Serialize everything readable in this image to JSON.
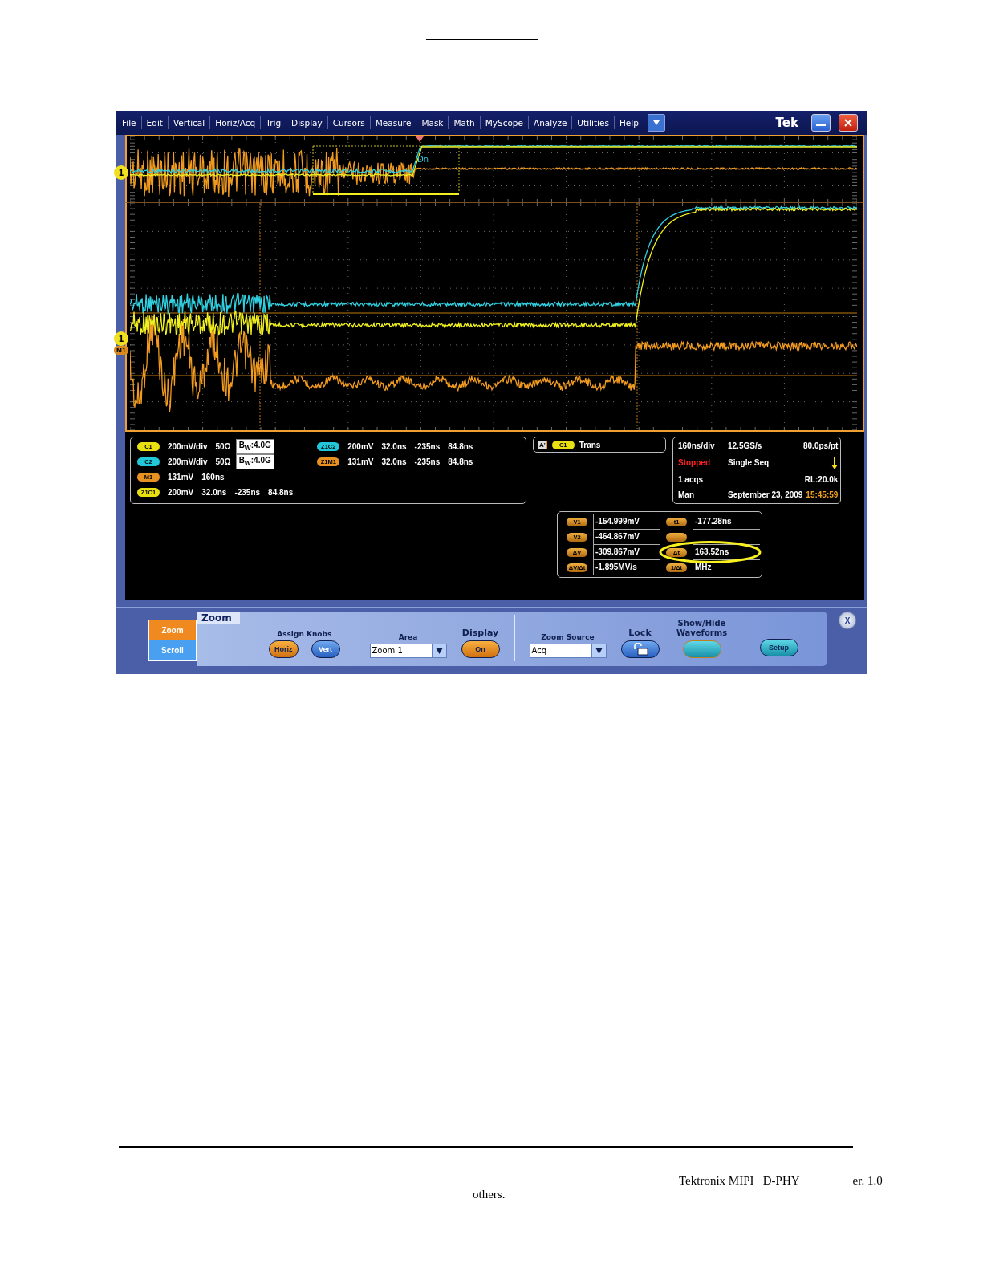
{
  "menu_bar": {
    "items": [
      "File",
      "Edit",
      "Vertical",
      "Horiz/Acq",
      "Trig",
      "Display",
      "Cursors",
      "Measure",
      "Mask",
      "Math",
      "MyScope",
      "Analyze",
      "Utilities",
      "Help"
    ],
    "logo": "Tek"
  },
  "overview_plot": {
    "marker": "1",
    "labels": [
      "Dn"
    ]
  },
  "zoom_plot": {
    "markers": [
      "1",
      "M1"
    ]
  },
  "channel_readouts": {
    "column_1": [
      {
        "badge": "C1",
        "color": "#e8e010",
        "values": [
          "200mV/div",
          "50Ω"
        ],
        "bandwidth": "B$_{W}$:4.0G"
      },
      {
        "badge": "C2",
        "color": "#20c8d8",
        "values": [
          "200mV/div",
          "50Ω"
        ],
        "bandwidth": "B$_{W}$:4.0G"
      },
      {
        "badge": "M1",
        "color": "#e89020",
        "values": [
          "131mV",
          "160ns"
        ]
      },
      {
        "badge": "Z1C1",
        "color": "#e8e010",
        "values": [
          "200mV",
          "32.0ns",
          "-235ns",
          "84.8ns"
        ]
      }
    ],
    "column_2": [
      {
        "badge": "Z1C2",
        "color": "#20c8d8",
        "values": [
          "200mV",
          "32.0ns",
          "-235ns",
          "84.8ns"
        ]
      },
      {
        "badge": "Z1M1",
        "color": "#e89020",
        "values": [
          "131mV",
          "32.0ns",
          "-235ns",
          "84.8ns"
        ]
      }
    ]
  },
  "trigger_readout": {
    "label": "A'",
    "badge": "C1",
    "type": "Trans"
  },
  "horizontal_readout": {
    "rows": [
      {
        "cells": [
          {
            "text": "160ns/div"
          },
          {
            "text": "12.5GS/s"
          },
          {
            "text": "80.0ps/pt"
          }
        ]
      },
      {
        "cells": [
          {
            "text": "Stopped",
            "color": "#ff2020"
          },
          {
            "text": "Single Seq"
          }
        ],
        "trigger_arrow": true
      },
      {
        "cells": [
          {
            "text": "1 acqs"
          },
          {
            "text": ""
          },
          {
            "text": "RL:20.0k"
          }
        ]
      },
      {
        "cells": [
          {
            "text": "Man"
          },
          {
            "text": "September 23, 2009"
          },
          {
            "text": "15:45:59",
            "color": "#f0a020"
          }
        ]
      }
    ]
  },
  "cursor_readout": [
    {
      "kind": "reading",
      "label": "V1",
      "value": "-154.999mV"
    },
    {
      "kind": "reading",
      "label": "t1",
      "value": "-177.28ns"
    },
    {
      "kind": "reading",
      "label": "V2",
      "value": "-464.867mV"
    },
    {
      "kind": "hidden"
    },
    {
      "kind": "reading",
      "label": "ΔV",
      "value": "-309.867mV"
    },
    {
      "kind": "reading",
      "label": "Δt",
      "value": "163.52ns"
    },
    {
      "kind": "reading",
      "label": "ΔV/Δt",
      "value": "-1.895MV/s"
    },
    {
      "kind": "reading",
      "label": "1/Δt",
      "value": "MHz"
    }
  ],
  "control_panel": {
    "tabs": [
      {
        "label": "Zoom",
        "selected": true
      },
      {
        "label": "Scroll",
        "selected": false
      }
    ],
    "title": "Zoom",
    "assign_knobs": {
      "label": "Assign Knobs",
      "buttons": [
        {
          "label": "Horiz",
          "selected": true
        },
        {
          "label": "Vert",
          "selected": false
        }
      ]
    },
    "area": {
      "label": "Area",
      "value": "Zoom 1"
    },
    "display": {
      "label": "Display",
      "button": "On"
    },
    "zoom_source": {
      "label": "Zoom Source",
      "value": "Acq"
    },
    "lock": {
      "label": "Lock"
    },
    "show_hide": {
      "label": "Show/Hide Waveforms"
    },
    "setup": "Setup",
    "close": "X"
  },
  "footer": {
    "title": "Tektronix MIPI   D-PHY",
    "version": "er. 1.0",
    "note": "others."
  }
}
